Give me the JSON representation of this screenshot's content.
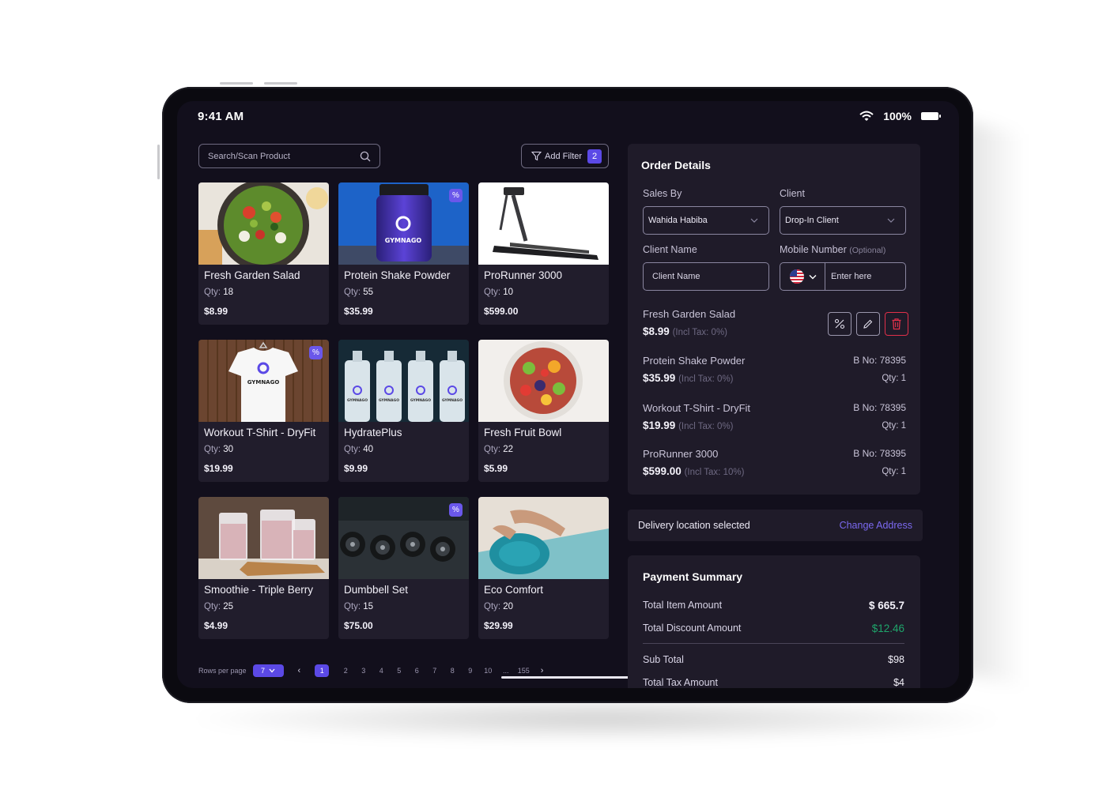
{
  "status_bar": {
    "time": "9:41 AM",
    "battery": "100%"
  },
  "search": {
    "placeholder": "Search/Scan Product"
  },
  "filter": {
    "label": "Add Filter",
    "count": "2"
  },
  "products": [
    {
      "name": "Fresh Garden Salad",
      "qty_label": "Qty: ",
      "qty": "18",
      "price": "$8.99",
      "discount": false,
      "image": "salad"
    },
    {
      "name": "Protein Shake Powder",
      "qty_label": "Qty: ",
      "qty": "55",
      "price": "$35.99",
      "discount": true,
      "image": "protein",
      "brand": "GYMNAGO"
    },
    {
      "name": "ProRunner 3000",
      "qty_label": "Qty: ",
      "qty": "10",
      "price": "$599.00",
      "discount": false,
      "image": "treadmill"
    },
    {
      "name": "Workout T-Shirt - DryFit",
      "qty_label": "Qty: ",
      "qty": "30",
      "price": "$19.99",
      "discount": true,
      "image": "tshirt",
      "brand": "GYMNAGO"
    },
    {
      "name": "HydratePlus",
      "qty_label": "Qty: ",
      "qty": "40",
      "price": "$9.99",
      "discount": false,
      "image": "bottles",
      "brand": "GYMNAGO"
    },
    {
      "name": "Fresh Fruit Bowl",
      "qty_label": "Qty: ",
      "qty": "22",
      "price": "$5.99",
      "discount": false,
      "image": "fruit"
    },
    {
      "name": "Smoothie - Triple Berry",
      "qty_label": "Qty: ",
      "qty": "25",
      "price": "$4.99",
      "discount": false,
      "image": "smoothie"
    },
    {
      "name": "Dumbbell Set",
      "qty_label": "Qty: ",
      "qty": "15",
      "price": "$75.00",
      "discount": true,
      "image": "dumbbells"
    },
    {
      "name": "Eco Comfort",
      "qty_label": "Qty: ",
      "qty": "20",
      "price": "$29.99",
      "discount": false,
      "image": "mat"
    }
  ],
  "pagination": {
    "rows_label": "Rows per page",
    "rows_value": "7",
    "pages": [
      "1",
      "2",
      "3",
      "4",
      "5",
      "6",
      "7",
      "8",
      "9",
      "10",
      "...",
      "155"
    ],
    "current": "1"
  },
  "order": {
    "title": "Order Details",
    "sales_by_label": "Sales By",
    "sales_by_value": "Wahida Habiba",
    "client_label": "Client",
    "client_value": "Drop-In Client",
    "client_name_label": "Client Name",
    "client_name_placeholder": "Client Name",
    "mobile_label": "Mobile Number",
    "mobile_optional": "(Optional)",
    "mobile_placeholder": "Enter here",
    "items": [
      {
        "name": "Fresh Garden Salad",
        "price": "$8.99",
        "tax": "(Incl Tax: 0%)",
        "bno": "",
        "qty": ""
      },
      {
        "name": "Protein Shake Powder",
        "price": "$35.99",
        "tax": "(Incl Tax: 0%)",
        "bno": "B No: 78395",
        "qty": "Qty: 1"
      },
      {
        "name": "Workout T-Shirt - DryFit",
        "price": "$19.99",
        "tax": "(Incl Tax: 0%)",
        "bno": "B No: 78395",
        "qty": "Qty: 1"
      },
      {
        "name": "ProRunner 3000",
        "price": "$599.00",
        "tax": "(Incl Tax: 10%)",
        "bno": "B No: 78395",
        "qty": "Qty: 1"
      }
    ]
  },
  "delivery": {
    "text": "Delivery location selected",
    "action": "Change Address"
  },
  "payment": {
    "title": "Payment Summary",
    "rows": [
      {
        "label": "Total Item Amount",
        "value": "$ 665.7"
      },
      {
        "label": "Total Discount Amount",
        "value": "$12.46"
      },
      {
        "label": "Sub Total",
        "value": "$98"
      },
      {
        "label": "Total Tax Amount",
        "value": "$4"
      }
    ]
  },
  "colors": {
    "accent": "#5b49e6",
    "discount_green": "#1fa56b",
    "delete_red": "#e0304a",
    "panel": "#1f1b29",
    "screen_bg": "#120f1c"
  }
}
